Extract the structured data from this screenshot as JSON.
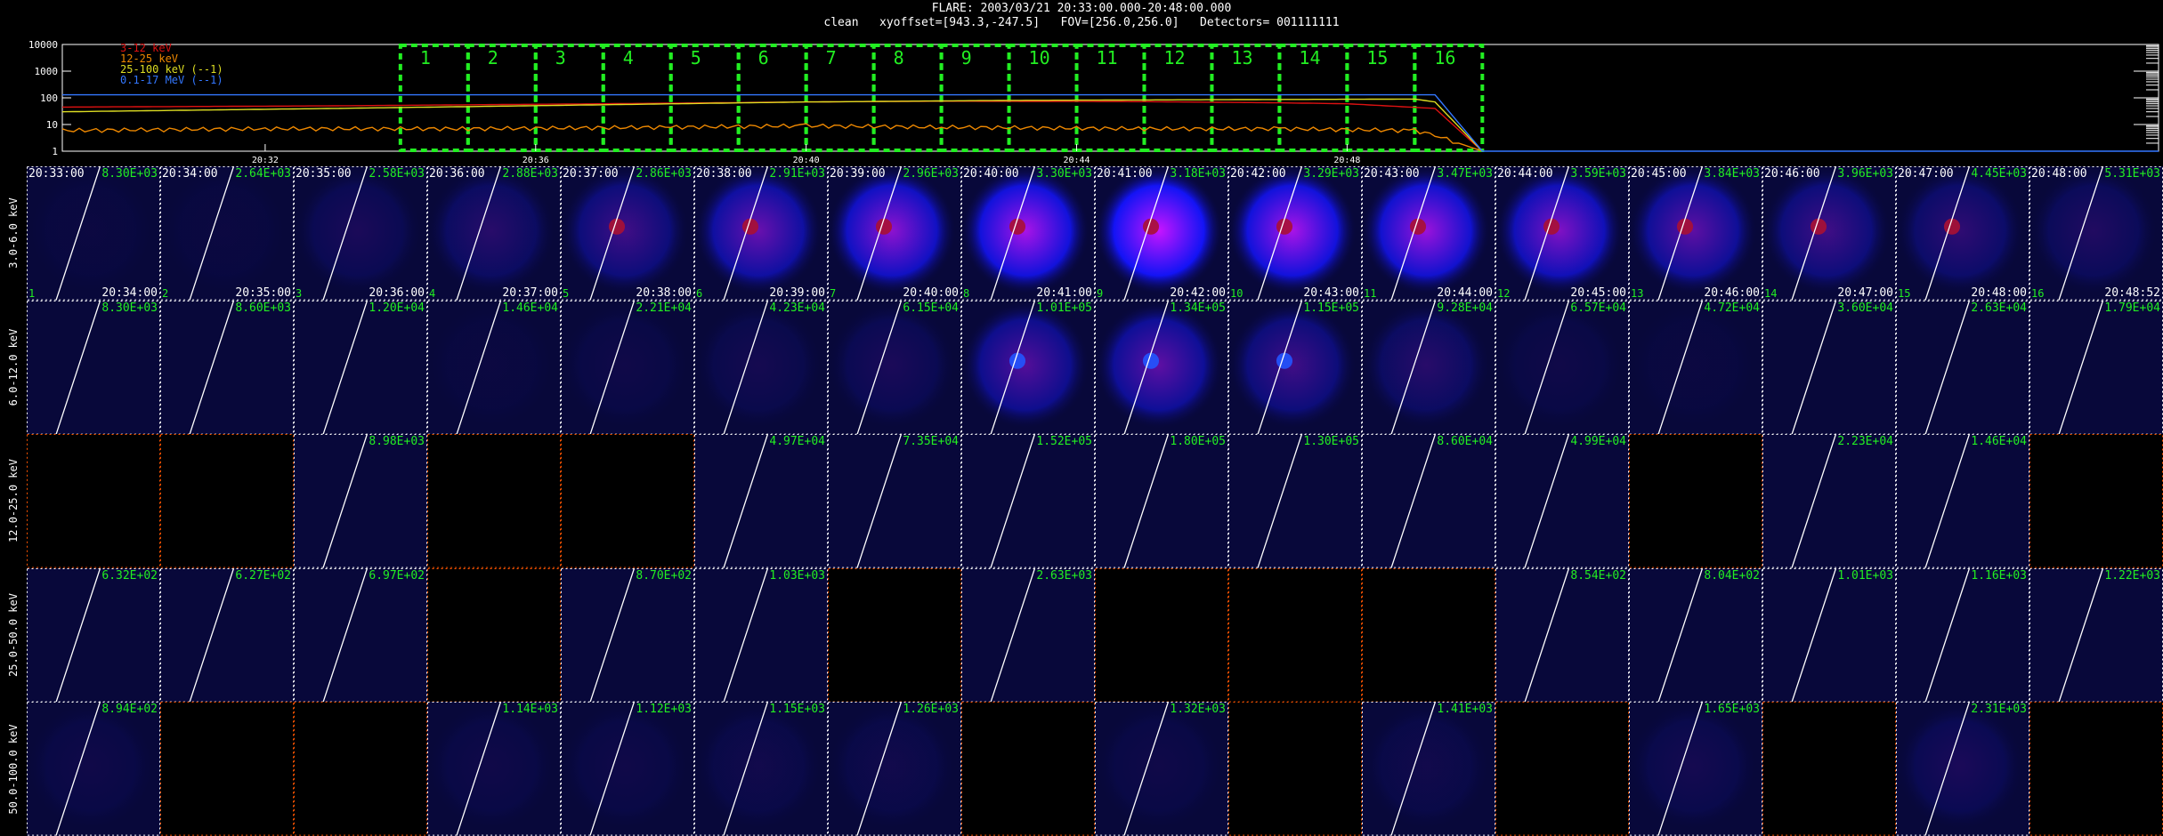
{
  "header": {
    "line1": "FLARE: 2003/03/21 20:33:00.000-20:48:00.000",
    "line2": "clean   xyoffset=[943.3,-247.5]   FOV=[256.0,256.0]   Detectors= 001111111"
  },
  "colors": {
    "low": "#dd1111",
    "mid": "#ee8800",
    "high": "#dddd22",
    "gamma": "#3377ff",
    "box": "#22ee22",
    "empty_edge": "#ff5500"
  },
  "chart_data": [
    {
      "type": "line",
      "name": "lightcurve",
      "y_scale": "log",
      "ylim": [
        1,
        10000
      ],
      "y_ticks": [
        "10000",
        "1000",
        "100",
        "10",
        "1"
      ],
      "x_range_minutes": [
        0,
        31
      ],
      "x_ticks": [
        {
          "label": "20:32",
          "x": 3
        },
        {
          "label": "20:36",
          "x": 7
        },
        {
          "label": "20:40",
          "x": 11
        },
        {
          "label": "20:44",
          "x": 15
        },
        {
          "label": "20:48",
          "x": 19
        }
      ],
      "series": [
        {
          "name": "3-12 keV",
          "color_key": "low",
          "x": [
            0,
            4,
            8,
            11,
            13,
            16,
            18,
            19,
            20.3,
            21
          ],
          "y": [
            45,
            50,
            60,
            70,
            75,
            72,
            65,
            60,
            40,
            1
          ]
        },
        {
          "name": "12-25 keV",
          "color_key": "mid",
          "x": [
            0,
            3,
            6,
            9,
            11,
            13,
            16,
            18,
            20,
            20.3,
            21
          ],
          "y": [
            6,
            7,
            7,
            8,
            9,
            8,
            7,
            7,
            6,
            4,
            1
          ]
        },
        {
          "name": "25-100 keV (--1)",
          "color_key": "high",
          "x": [
            0,
            4,
            8,
            11,
            14,
            17,
            20,
            20.3,
            21
          ],
          "y": [
            30,
            40,
            55,
            70,
            80,
            85,
            90,
            70,
            1
          ]
        },
        {
          "name": "0.1-17 MeV (--1)",
          "color_key": "gamma",
          "x": [
            0,
            5,
            10,
            15,
            20.3,
            21,
            31
          ],
          "y": [
            130,
            130,
            130,
            130,
            130,
            1,
            1
          ]
        }
      ],
      "time_boxes": {
        "start_min": 5,
        "width_min": 1,
        "labels": [
          "1",
          "2",
          "3",
          "4",
          "5",
          "6",
          "7",
          "8",
          "9",
          "10",
          "11",
          "12",
          "13",
          "14",
          "15",
          "16"
        ]
      }
    },
    {
      "type": "heatmap",
      "name": "image-grid",
      "energy_bands": [
        "3.0-6.0 keV",
        "6.0-12.0 keV",
        "12.0-25.0 keV",
        "25.0-50.0 keV",
        "50.0-100.0 keV"
      ],
      "start_times": [
        "20:33:00",
        "20:34:00",
        "20:35:00",
        "20:36:00",
        "20:37:00",
        "20:38:00",
        "20:39:00",
        "20:40:00",
        "20:41:00",
        "20:42:00",
        "20:43:00",
        "20:44:00",
        "20:45:00",
        "20:46:00",
        "20:47:00",
        "20:48:00"
      ],
      "end_times": [
        "20:34:00",
        "20:35:00",
        "20:36:00",
        "20:37:00",
        "20:38:00",
        "20:39:00",
        "20:40:00",
        "20:41:00",
        "20:42:00",
        "20:43:00",
        "20:44:00",
        "20:45:00",
        "20:46:00",
        "20:47:00",
        "20:48:00",
        "20:48:52"
      ],
      "indices": [
        "1",
        "2",
        "3",
        "4",
        "5",
        "6",
        "7",
        "8",
        "9",
        "10",
        "11",
        "12",
        "13",
        "14",
        "15",
        "16"
      ],
      "maxima": [
        [
          "8.30E+03",
          "2.64E+03",
          "2.58E+03",
          "2.88E+03",
          "2.86E+03",
          "2.91E+03",
          "2.96E+03",
          "3.30E+03",
          "3.18E+03",
          "3.29E+03",
          "3.47E+03",
          "3.59E+03",
          "3.84E+03",
          "3.96E+03",
          "4.45E+03",
          "5.31E+03"
        ],
        [
          "8.30E+03",
          "8.60E+03",
          "1.20E+04",
          "1.46E+04",
          "2.21E+04",
          "4.23E+04",
          "6.15E+04",
          "1.01E+05",
          "1.34E+05",
          "1.15E+05",
          "9.28E+04",
          "6.57E+04",
          "4.72E+04",
          "3.60E+04",
          "2.63E+04",
          "1.79E+04"
        ],
        [
          "",
          "",
          "8.98E+03",
          "",
          "",
          "4.97E+04",
          "7.35E+04",
          "1.52E+05",
          "1.80E+05",
          "1.30E+05",
          "8.60E+04",
          "4.99E+04",
          "",
          "2.23E+04",
          "1.46E+04",
          ""
        ],
        [
          "6.32E+02",
          "6.27E+02",
          "6.97E+02",
          "",
          "8.70E+02",
          "1.03E+03",
          "",
          "2.63E+03",
          "",
          "",
          "",
          "8.54E+02",
          "8.04E+02",
          "1.01E+03",
          "1.16E+03",
          "1.22E+03"
        ],
        [
          "8.94E+02",
          "",
          "",
          "1.14E+03",
          "1.12E+03",
          "1.15E+03",
          "1.26E+03",
          "",
          "1.32E+03",
          "",
          "1.41E+03",
          "",
          "1.65E+03",
          "",
          "2.31E+03",
          ""
        ]
      ],
      "intensity": [
        [
          0.05,
          0.05,
          0.2,
          0.3,
          0.45,
          0.65,
          0.8,
          0.9,
          1.0,
          0.9,
          0.85,
          0.75,
          0.6,
          0.45,
          0.35,
          0.25
        ],
        [
          0.0,
          0.0,
          0.0,
          0.05,
          0.1,
          0.15,
          0.2,
          0.55,
          0.6,
          0.45,
          0.3,
          0.1,
          0.05,
          0.0,
          0.0,
          0.0
        ],
        [
          0,
          0,
          0,
          0,
          0,
          0,
          0,
          0,
          0,
          0,
          0,
          0,
          0,
          0,
          0,
          0
        ],
        [
          0,
          0,
          0,
          0,
          0,
          0,
          0,
          0,
          0,
          0,
          0,
          0,
          0,
          0,
          0,
          0
        ],
        [
          0.1,
          0,
          0,
          0.1,
          0.1,
          0.12,
          0.12,
          0,
          0.1,
          0,
          0.12,
          0,
          0.15,
          0,
          0.2,
          0
        ]
      ],
      "empty_cells": [
        [],
        [],
        [
          0,
          1,
          3,
          4,
          12,
          15
        ],
        [
          3,
          6,
          8,
          9,
          10
        ],
        [
          1,
          2,
          7,
          9,
          11,
          13,
          15
        ]
      ]
    }
  ]
}
